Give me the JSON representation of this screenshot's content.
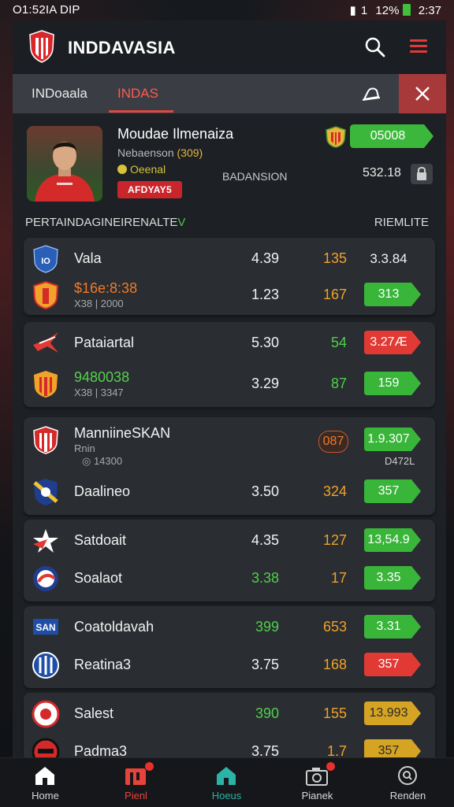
{
  "status_bar": {
    "left": "O1:52IA DIP",
    "signal": "1",
    "battery": "12%",
    "time": "2:37"
  },
  "header": {
    "title": "INDDAVASIA"
  },
  "tabs": [
    {
      "label": "INDoaala"
    },
    {
      "label": "INDAS"
    }
  ],
  "featured": {
    "name": "Moudae Ilmenaiza",
    "sub_prefix": "Nebaenson",
    "sub_highlight": "(309)",
    "tag": "Oeenal",
    "badge": "AFDYAY5",
    "middle_label": "BADANSION",
    "odd": "05008",
    "value": "532.18"
  },
  "section": {
    "left": "PERTAINDAGINE",
    "left_mid": "IRENALTE",
    "left_accent": "V",
    "right": "RIEMLITE"
  },
  "matches": [
    {
      "rows": [
        {
          "crest": "blue-shield",
          "name": "Vala",
          "name_color": "white",
          "odd1": "4.39",
          "odd2": "135",
          "odd2_color": "orange",
          "pill": "3.3.84",
          "pill_style": "plain"
        },
        {
          "crest": "orange-red-shield",
          "name": "$16e:8:38",
          "name_color": "orange",
          "sub": "X38 | 2000",
          "odd1": "1.23",
          "odd2": "167",
          "odd2_color": "orange",
          "pill": "313",
          "pill_style": "green"
        }
      ]
    },
    {
      "rows": [
        {
          "crest": "red-star-wing",
          "name": "Pataiartal",
          "name_color": "white",
          "odd1": "5.30",
          "odd2": "54",
          "odd2_color": "green",
          "pill": "3.27Æ",
          "pill_style": "red"
        },
        {
          "crest": "striped-shield",
          "name": "9480038",
          "name_color": "green",
          "sub": "X38 | 3347",
          "odd1": "3.29",
          "odd2": "87",
          "odd2_color": "green",
          "pill": "159",
          "pill_style": "green"
        }
      ]
    },
    {
      "rows": [
        {
          "crest": "red-white-shield",
          "name": "ManniineSKAN",
          "name_color": "white",
          "sub": "Rnin",
          "sub2": "14300",
          "odd1": "",
          "odd2": "087",
          "odd2_color": "chip",
          "pill": "1.9.307",
          "pill_style": "green",
          "subvalue": "D472L"
        },
        {
          "crest": "blue-yellow-shield",
          "name": "Daalineo",
          "name_color": "white",
          "odd1": "3.50",
          "odd2": "324",
          "odd2_color": "orange",
          "pill": "357",
          "pill_style": "green"
        }
      ]
    },
    {
      "rows": [
        {
          "crest": "red-star",
          "name": "Satdoait",
          "name_color": "white",
          "odd1": "4.35",
          "odd2": "127",
          "odd2_color": "orange",
          "pill": "13,54.9",
          "pill_style": "green"
        },
        {
          "crest": "blue-red-round",
          "name": "Soalaot",
          "name_color": "white",
          "odd1": "3.38",
          "odd1_color": "green",
          "odd2": "17",
          "odd2_color": "orange",
          "pill": "3.35",
          "pill_style": "green"
        }
      ]
    },
    {
      "rows": [
        {
          "crest": "blue-text-crest",
          "crest_text": "SAN",
          "name": "Coatoldavah",
          "name_color": "white",
          "odd1": "399",
          "odd1_color": "green",
          "odd2": "653",
          "odd2_color": "orange",
          "pill": "3.31",
          "pill_style": "green"
        },
        {
          "crest": "blue-white-round",
          "name": "Reatina3",
          "name_color": "white",
          "odd1": "3.75",
          "odd2": "168",
          "odd2_color": "orange",
          "pill": "357",
          "pill_style": "red"
        }
      ]
    },
    {
      "rows": [
        {
          "crest": "white-round",
          "name": "Salest",
          "name_color": "white",
          "odd1": "390",
          "odd1_color": "green",
          "odd2": "155",
          "odd2_color": "orange",
          "pill": "13.993",
          "pill_style": "gold"
        },
        {
          "crest": "red-black-round",
          "name": "Padma3",
          "name_color": "white",
          "odd1": "3.75",
          "odd2": "1.7",
          "odd2_color": "orange",
          "pill": "357",
          "pill_style": "gold"
        }
      ]
    }
  ],
  "bottom_nav": [
    {
      "label": "Home",
      "icon": "home-icon",
      "color": "#ffffff"
    },
    {
      "label": "Pienl",
      "icon": "flag-icon",
      "color": "#e8433a"
    },
    {
      "label": "Hoeus",
      "icon": "home-teal-icon",
      "color": "#2bb3a8"
    },
    {
      "label": "Pianek",
      "icon": "camera-icon",
      "color": "#cfcfcf"
    },
    {
      "label": "Renden",
      "icon": "search-circle-icon",
      "color": "#cfcfcf"
    }
  ],
  "colors": {
    "accent": "#e2473d",
    "green": "#39b53a",
    "red": "#e13a35",
    "gold": "#d6a423",
    "card": "#2a2d32"
  }
}
